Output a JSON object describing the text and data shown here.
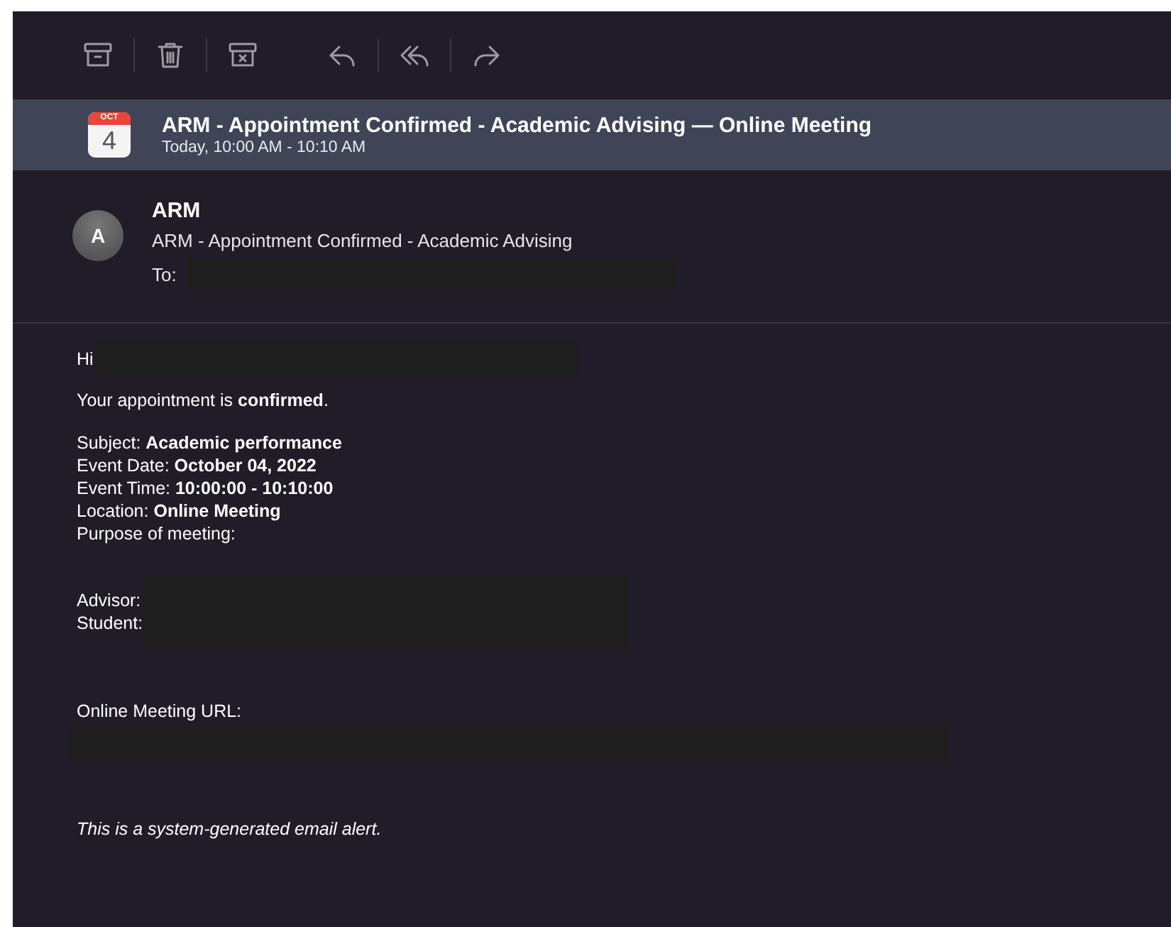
{
  "toolbar": {
    "buttons": [
      {
        "kind": "archive"
      },
      {
        "kind": "trash"
      },
      {
        "kind": "junk"
      },
      {
        "kind": "reply"
      },
      {
        "kind": "reply-all"
      },
      {
        "kind": "forward"
      }
    ]
  },
  "event": {
    "month": "OCT",
    "day": "4",
    "title": "ARM - Appointment Confirmed - Academic Advising — Online Meeting",
    "time": "Today, 10:00 AM - 10:10 AM"
  },
  "header": {
    "avatar": "A",
    "sender": "ARM",
    "subject": "ARM - Appointment Confirmed - Academic Advising",
    "to_label": "To:",
    "to_redacted": true
  },
  "body": [
    {
      "kind": "greeting",
      "text": "Hi",
      "redacted": true
    },
    {
      "kind": "paragraph",
      "text": "Your appointment is **confirmed**."
    },
    {
      "kind": "details",
      "lines": [
        "Subject: **Academic performance**",
        "Event Date: **October 04, 2022**",
        "Event Time: **10:00:00 - 10:10:00**",
        "Location: **Online Meeting**",
        "Purpose of meeting:"
      ]
    },
    {
      "kind": "people",
      "lines": [
        "Advisor:",
        "Student:"
      ],
      "redacted": true
    },
    {
      "kind": "url",
      "text": "Online Meeting URL:",
      "redacted": true
    },
    {
      "kind": "footer",
      "text": "This is a system-generated email alert."
    }
  ]
}
